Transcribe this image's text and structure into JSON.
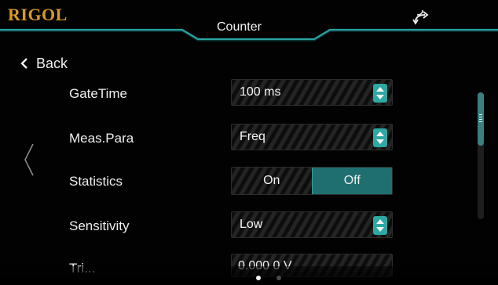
{
  "header": {
    "brand": "RIGOL",
    "title": "Counter",
    "sync_icon": "sync-arrows-icon"
  },
  "nav": {
    "back_label": "Back",
    "prev_page_icon": "chevron-left-icon"
  },
  "settings": {
    "gate_time": {
      "label": "GateTime",
      "value": "100 ms"
    },
    "meas_para": {
      "label": "Meas.Para",
      "value": "Freq"
    },
    "statistics": {
      "label": "Statistics",
      "on_label": "On",
      "off_label": "Off",
      "selected": "Off"
    },
    "sensitivity": {
      "label": "Sensitivity",
      "value": "Low"
    },
    "trigger": {
      "label": "Tri...",
      "value": "0.000 0 V"
    }
  },
  "scrollbar": {
    "position": 0.0
  },
  "pager": {
    "page_count": 2,
    "current_page": 1
  },
  "colors": {
    "accent": "#2fa8a3",
    "brand": "#d99a25",
    "selected_toggle": "#1f6f70",
    "background": "#020202"
  }
}
